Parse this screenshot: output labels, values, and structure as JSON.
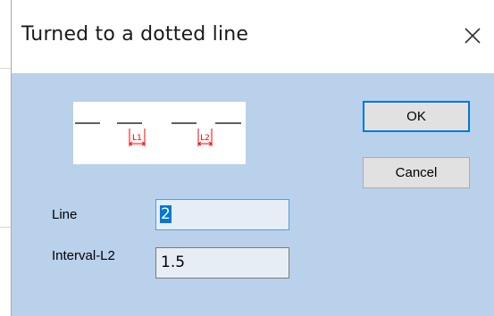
{
  "dialog": {
    "title": "Turned to a dotted line",
    "close_glyph": "×"
  },
  "preview": {
    "marker_1": "L1",
    "marker_2": "L2",
    "line_color": "#000000",
    "marker_color": "#ff0000"
  },
  "buttons": {
    "ok": "OK",
    "cancel": "Cancel"
  },
  "fields": {
    "line_label": "Line",
    "line_value": "2",
    "interval_label": "Interval-L2",
    "interval_value": "1.5"
  },
  "colors": {
    "dialog_background": "#b9d1ea",
    "default_button_border": "#0078d7",
    "selection": "#0078d7"
  }
}
